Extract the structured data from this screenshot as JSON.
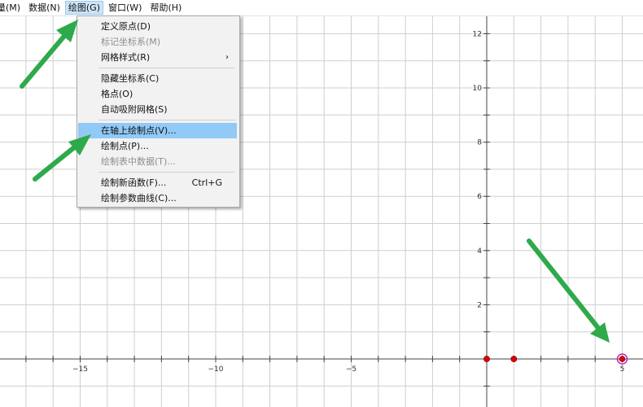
{
  "menubar": {
    "items": [
      {
        "label": "量(M)"
      },
      {
        "label": "数据(N)"
      },
      {
        "label": "绘图(G)"
      },
      {
        "label": "窗口(W)"
      },
      {
        "label": "帮助(H)"
      }
    ],
    "active_index": 2
  },
  "draw_menu": {
    "items": [
      {
        "label": "定义原点(D)",
        "shortcut": "",
        "submenu": false,
        "disabled": false,
        "highlighted": false
      },
      {
        "label": "标记坐标系(M)",
        "shortcut": "",
        "submenu": false,
        "disabled": true,
        "highlighted": false
      },
      {
        "label": "网格样式(R)",
        "shortcut": "",
        "submenu": true,
        "disabled": false,
        "highlighted": false
      },
      {
        "label": "隐藏坐标系(C)",
        "shortcut": "",
        "submenu": false,
        "disabled": false,
        "highlighted": false
      },
      {
        "label": "格点(O)",
        "shortcut": "",
        "submenu": false,
        "disabled": false,
        "highlighted": false
      },
      {
        "label": "自动吸附网格(S)",
        "shortcut": "",
        "submenu": false,
        "disabled": false,
        "highlighted": false
      },
      {
        "label": "在轴上绘制点(V)...",
        "shortcut": "",
        "submenu": false,
        "disabled": false,
        "highlighted": true
      },
      {
        "label": "绘制点(P)...",
        "shortcut": "",
        "submenu": false,
        "disabled": false,
        "highlighted": false
      },
      {
        "label": "绘制表中数据(T)...",
        "shortcut": "",
        "submenu": false,
        "disabled": true,
        "highlighted": false
      },
      {
        "label": "绘制新函数(F)...",
        "shortcut": "Ctrl+G",
        "submenu": false,
        "disabled": false,
        "highlighted": false
      },
      {
        "label": "绘制参数曲线(C)...",
        "shortcut": "",
        "submenu": false,
        "disabled": false,
        "highlighted": false
      }
    ]
  },
  "graph": {
    "x_tick_labels": [
      {
        "value": -15,
        "text": "−15"
      },
      {
        "value": -10,
        "text": "−10"
      },
      {
        "value": -5,
        "text": "−5"
      },
      {
        "value": 5,
        "text": "5"
      }
    ],
    "y_tick_labels": [
      {
        "value": 2,
        "text": "2"
      },
      {
        "value": 4,
        "text": "4"
      },
      {
        "value": 6,
        "text": "6"
      },
      {
        "value": 8,
        "text": "8"
      },
      {
        "value": 10,
        "text": "10"
      },
      {
        "value": 12,
        "text": "12"
      }
    ],
    "points": [
      {
        "x": 0,
        "y": 0,
        "selected": false
      },
      {
        "x": 1,
        "y": 0,
        "selected": false
      },
      {
        "x": 5,
        "y": 0,
        "selected": true
      }
    ],
    "colors": {
      "grid": "#cfcfcf",
      "axis": "#444444",
      "point": "#e00000",
      "selected_ring": "#c020c0",
      "arrow": "#2eaa4a",
      "menu_highlight": "#91c9f7"
    }
  }
}
